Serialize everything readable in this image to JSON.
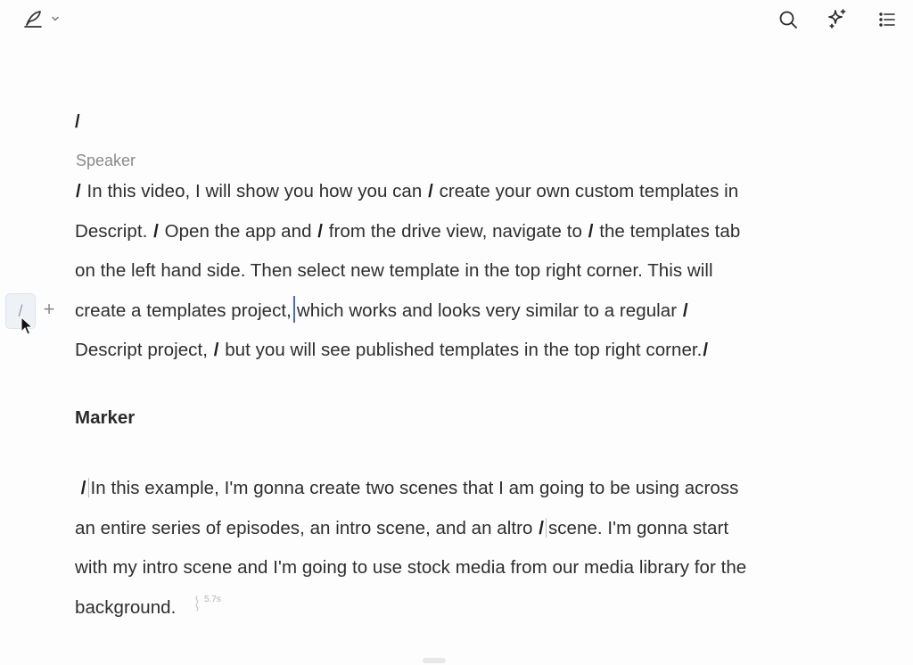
{
  "toolbar": {
    "brand_icon": "quill-pen-icon",
    "menu_icon": "chevron-down-icon",
    "search_icon": "search-icon",
    "ai_icon": "sparkle-icon",
    "outline_icon": "list-icon"
  },
  "document": {
    "leading_slash": "/",
    "speaker_label": "Speaker",
    "paragraph1": {
      "line1": {
        "s1": "/",
        "t1": " In this video, I will show you how you can ",
        "s2": "/",
        "t2": " create your own custom templates in"
      },
      "line2": {
        "t1": "Descript. ",
        "s1": "/",
        "t2": " Open the app and ",
        "s2": "/",
        "t3": " from the drive view, navigate to ",
        "s3": "/",
        "t4": " the templates tab"
      },
      "line3": {
        "t1": "on the left hand side. Then select new template in the top right corner. This will"
      },
      "line4": {
        "t1": "create a templates project,",
        "t2": "which works and looks very similar to a regular ",
        "s1": "/"
      },
      "line5": {
        "t1": "Descript project, ",
        "s1": "/",
        "t2": " but you will see published templates in the top right corner.",
        "s2": "/"
      }
    },
    "marker_heading": "Marker",
    "paragraph2": {
      "line1": {
        "s1": "/",
        "t1": "In this example, I'm gonna create two scenes that I am going to be using across"
      },
      "line2": {
        "t1": "an entire series of episodes, an intro scene, and an altro ",
        "s1": "/",
        "t2": "scene. I'm gonna start"
      },
      "line3": {
        "t1": "with my intro scene and I'm going to use stock media from our media library for the"
      },
      "line4": {
        "t1": "background."
      }
    },
    "pause_duration": "5.7s"
  },
  "gutter": {
    "slash_label": "/",
    "plus_label": "+"
  },
  "colors": {
    "caret": "#4a66d9",
    "text": "#2e2e2e",
    "muted": "#8a8a8a",
    "background": "#fdfdfd"
  }
}
